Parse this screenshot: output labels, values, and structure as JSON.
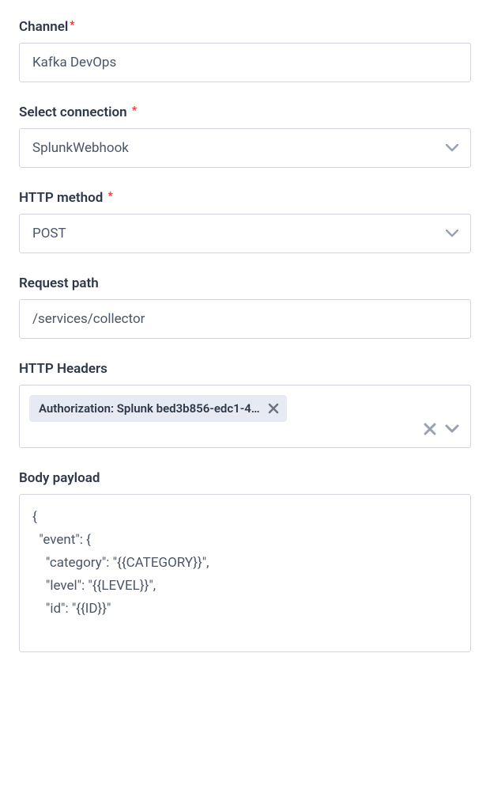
{
  "channel": {
    "label": "Channel",
    "value": "Kafka DevOps"
  },
  "connection": {
    "label": "Select connection",
    "value": "SplunkWebhook"
  },
  "http_method": {
    "label": "HTTP method",
    "value": "POST"
  },
  "request_path": {
    "label": "Request path",
    "value": "/services/collector"
  },
  "http_headers": {
    "label": "HTTP Headers",
    "chip": "Authorization: Splunk bed3b856-edc1-4…"
  },
  "body_payload": {
    "label": "Body payload",
    "value": "{\n  \"event\": {\n    \"category\": \"{{CATEGORY}}\",\n    \"level\": \"{{LEVEL}}\",\n    \"id\": \"{{ID}}\""
  }
}
